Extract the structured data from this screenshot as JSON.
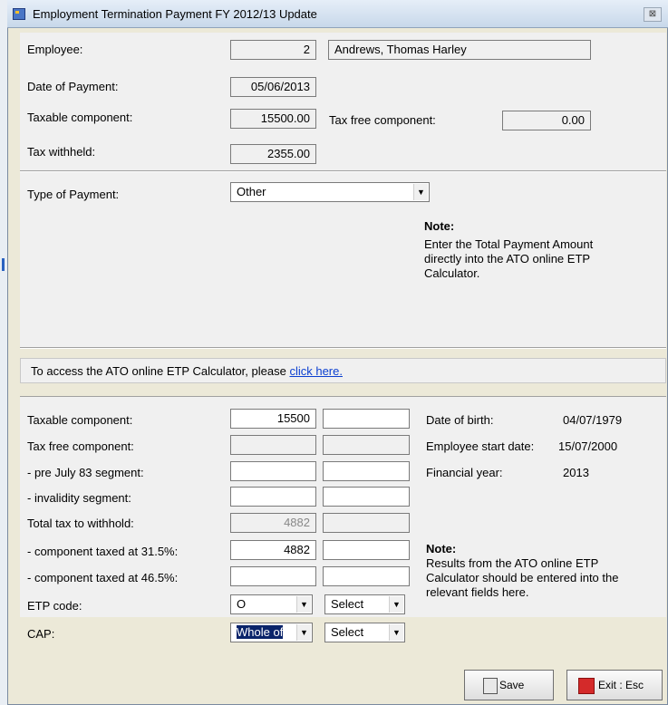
{
  "window": {
    "title": "Employment Termination Payment FY 2012/13 Update",
    "close_glyph": "⊠"
  },
  "employee_section": {
    "employee_label": "Employee:",
    "employee_number": "2",
    "employee_name": "Andrews, Thomas  Harley",
    "date_label": "Date of Payment:",
    "date_value": "05/06/2013",
    "taxable_label": "Taxable component:",
    "taxable_value": "15500.00",
    "taxfree_label": "Tax free component:",
    "taxfree_value": "0.00",
    "withheld_label": "Tax withheld:",
    "withheld_value": "2355.00"
  },
  "payment_type": {
    "label": "Type of Payment:",
    "selected": "Other",
    "note_heading": "Note:",
    "note_lines": [
      "Enter the Total Payment Amount",
      "directly into the ATO online ETP",
      "Calculator."
    ]
  },
  "ato_link": {
    "prefix": "To access the ATO online ETP Calculator, please",
    "link_text": "click here."
  },
  "calc": {
    "rows": {
      "taxable": {
        "label": "Taxable component:",
        "col1": "15500",
        "col2": ""
      },
      "taxfree": {
        "label": "Tax free component:",
        "col1": "",
        "col2": ""
      },
      "prejuly": {
        "label": " - pre July 83 segment:",
        "col1": "",
        "col2": ""
      },
      "invalidity": {
        "label": " - invalidity segment:",
        "col1": "",
        "col2": ""
      },
      "totaltax": {
        "label": "Total tax to withhold:",
        "col1": "4882",
        "col2": ""
      },
      "at315": {
        "label": " - component taxed at 31.5%:",
        "col1": "4882",
        "col2": ""
      },
      "at465": {
        "label": " - component taxed at 46.5%:",
        "col1": "",
        "col2": ""
      },
      "etpcode": {
        "label": "ETP code:",
        "col1": "O",
        "col2": "Select"
      },
      "cap": {
        "label": "CAP:",
        "col1": "Whole of",
        "col2": "Select"
      }
    },
    "info": {
      "dob_label": "Date of birth:",
      "dob_value": "04/07/1979",
      "start_label": "Employee start date:",
      "start_value": "15/07/2000",
      "fy_label": "Financial year:",
      "fy_value": "2013"
    },
    "note_heading": "Note:",
    "note_lines": [
      "Results from the ATO online ETP",
      "Calculator should be entered into the",
      "relevant fields here."
    ]
  },
  "buttons": {
    "save": "Save",
    "exit": "Exit : Esc"
  },
  "dropdown_glyph": "▼"
}
